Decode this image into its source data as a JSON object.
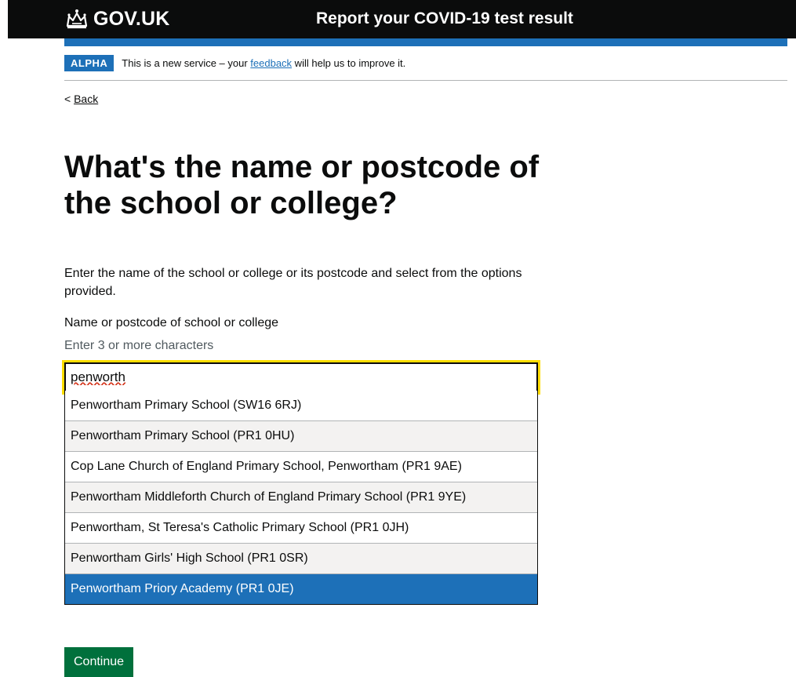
{
  "header": {
    "logo_text": "GOV.UK",
    "logo_icon": "crown-icon",
    "service_name": "Report your COVID-19 test result"
  },
  "phase_banner": {
    "tag": "ALPHA",
    "text_before": "This is a new service – your ",
    "link": "feedback",
    "text_after": " will help us to improve it."
  },
  "back_link": {
    "chevron": "<",
    "label": "Back"
  },
  "main": {
    "heading": "What's the name or postcode of the school or college?",
    "description": "Enter the name of the school or college or its postcode and select from the options provided.",
    "field_label": "Name or postcode of school or college",
    "field_hint": "Enter 3 or more characters",
    "input_value": "penworth"
  },
  "autocomplete": {
    "options": [
      "Penwortham Primary School (SW16 6RJ)",
      "Penwortham Primary School (PR1 0HU)",
      "Cop Lane Church of England Primary School, Penwortham (PR1 9AE)",
      "Penwortham Middleforth Church of England Primary School (PR1 9YE)",
      "Penwortham, St Teresa's Catholic Primary School (PR1 0JH)",
      "Penwortham Girls' High School (PR1 0SR)",
      "Penwortham Priory Academy (PR1 0JE)"
    ],
    "selected_index": 6
  },
  "actions": {
    "continue_label": "Continue"
  },
  "colors": {
    "header_bg": "#0b0c0c",
    "brand_blue": "#1d70b8",
    "focus_yellow": "#ffdd00",
    "button_green": "#00703c"
  }
}
